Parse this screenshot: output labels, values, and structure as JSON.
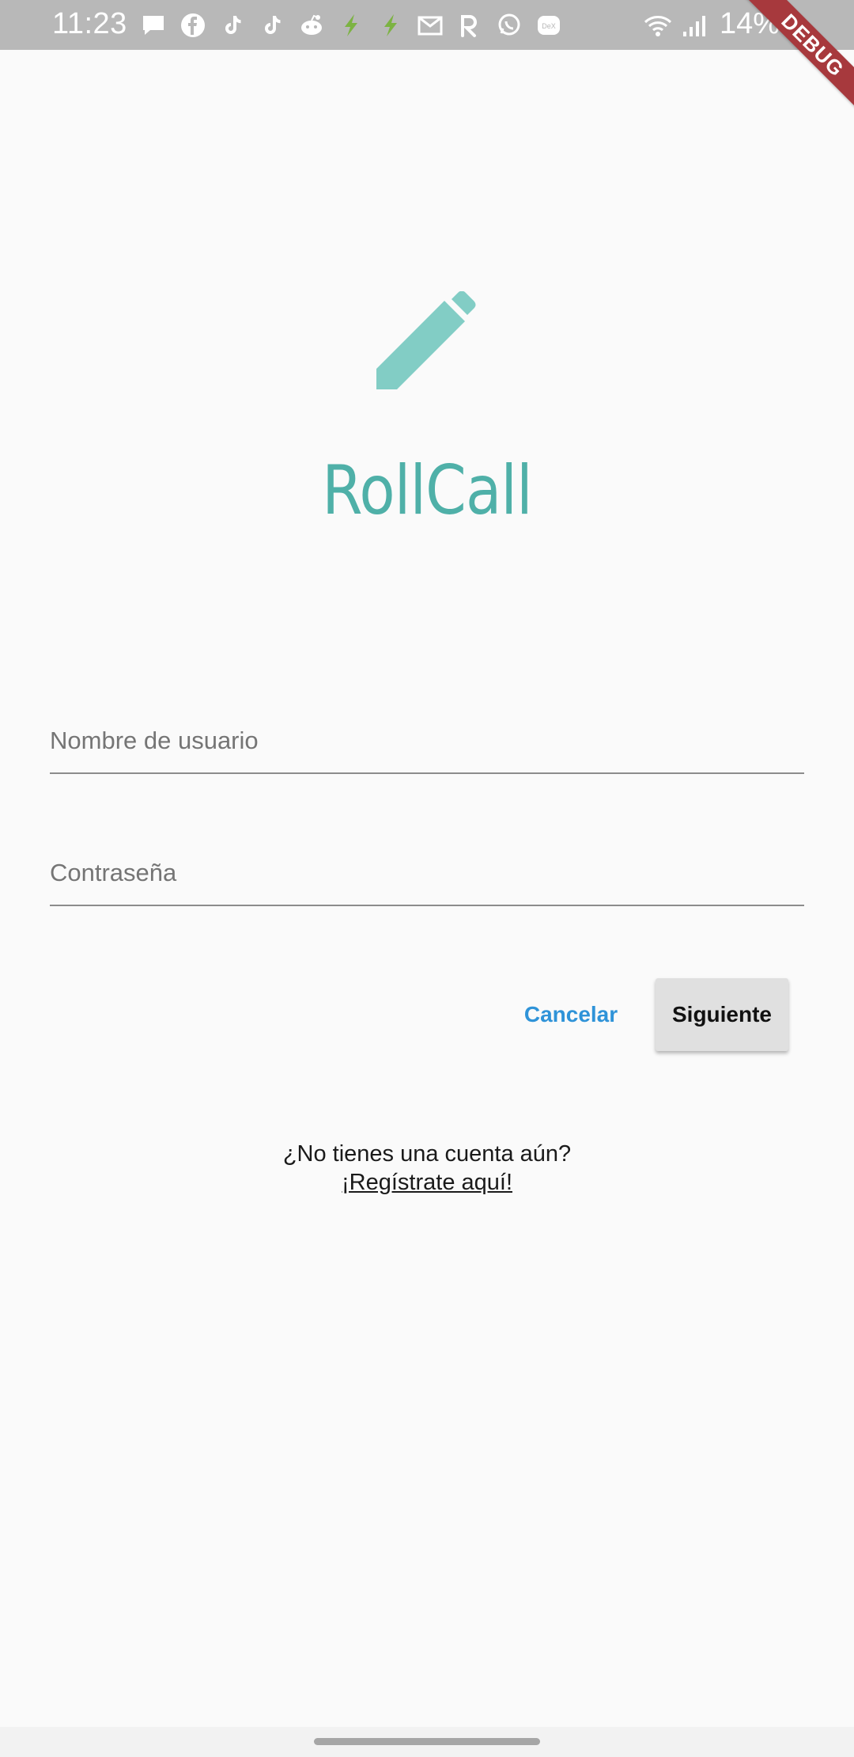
{
  "status_bar": {
    "time": "11:23",
    "battery": "14%",
    "notification_icons": [
      "message-icon",
      "facebook-icon",
      "tiktok-icon",
      "tiktok-icon",
      "reddit-icon",
      "green-bolt-icon",
      "green-bolt-icon",
      "gmail-icon",
      "r-app-icon",
      "whatsapp-icon",
      "dex-icon"
    ],
    "system_icons": [
      "wifi-icon",
      "signal-icon",
      "battery-icon"
    ]
  },
  "debug_banner": "DEBUG",
  "app": {
    "title": "RollCall",
    "logo_icon": "pencil-icon",
    "accent_color": "#4fb0a8",
    "icon_color": "#82cdc5"
  },
  "form": {
    "username_placeholder": "Nombre de usuario",
    "password_placeholder": "Contraseña"
  },
  "buttons": {
    "cancel_label": "Cancelar",
    "next_label": "Siguiente",
    "cancel_color": "#2f93d8"
  },
  "register": {
    "prompt": "¿No tienes una cuenta aún?",
    "link": "¡Regístrate aquí!"
  }
}
